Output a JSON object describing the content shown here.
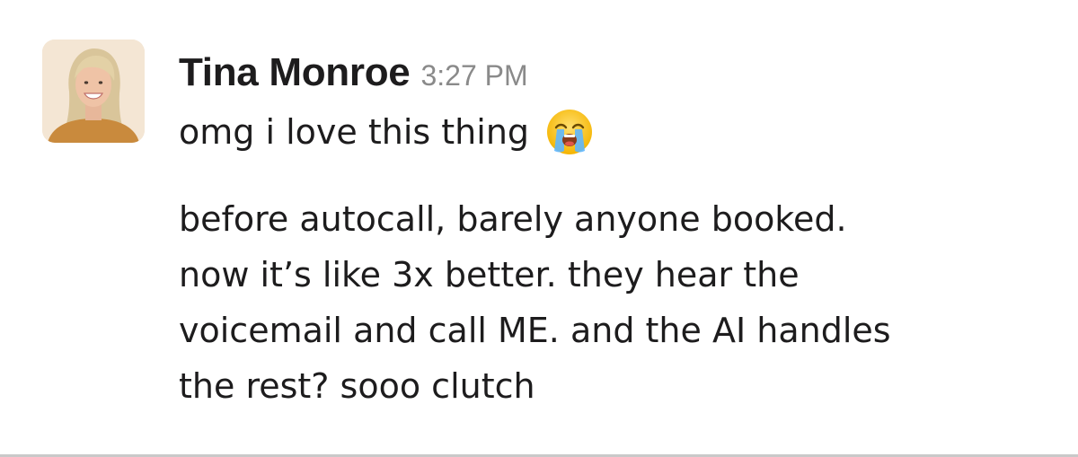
{
  "message": {
    "sender_name": "Tina Monroe",
    "timestamp": "3:27 PM",
    "first_line": "omg i love this thing",
    "emoji": "loudly-crying-face-icon",
    "body_lines": [
      "before autocall, barely anyone booked.",
      "now it’s like 3x better. they hear the",
      "voicemail and call ME. and the AI handles",
      "the rest? sooo clutch"
    ]
  },
  "colors": {
    "text": "#1d1c1d",
    "timestamp": "#8a8a8a",
    "divider": "#c9c9c9"
  }
}
